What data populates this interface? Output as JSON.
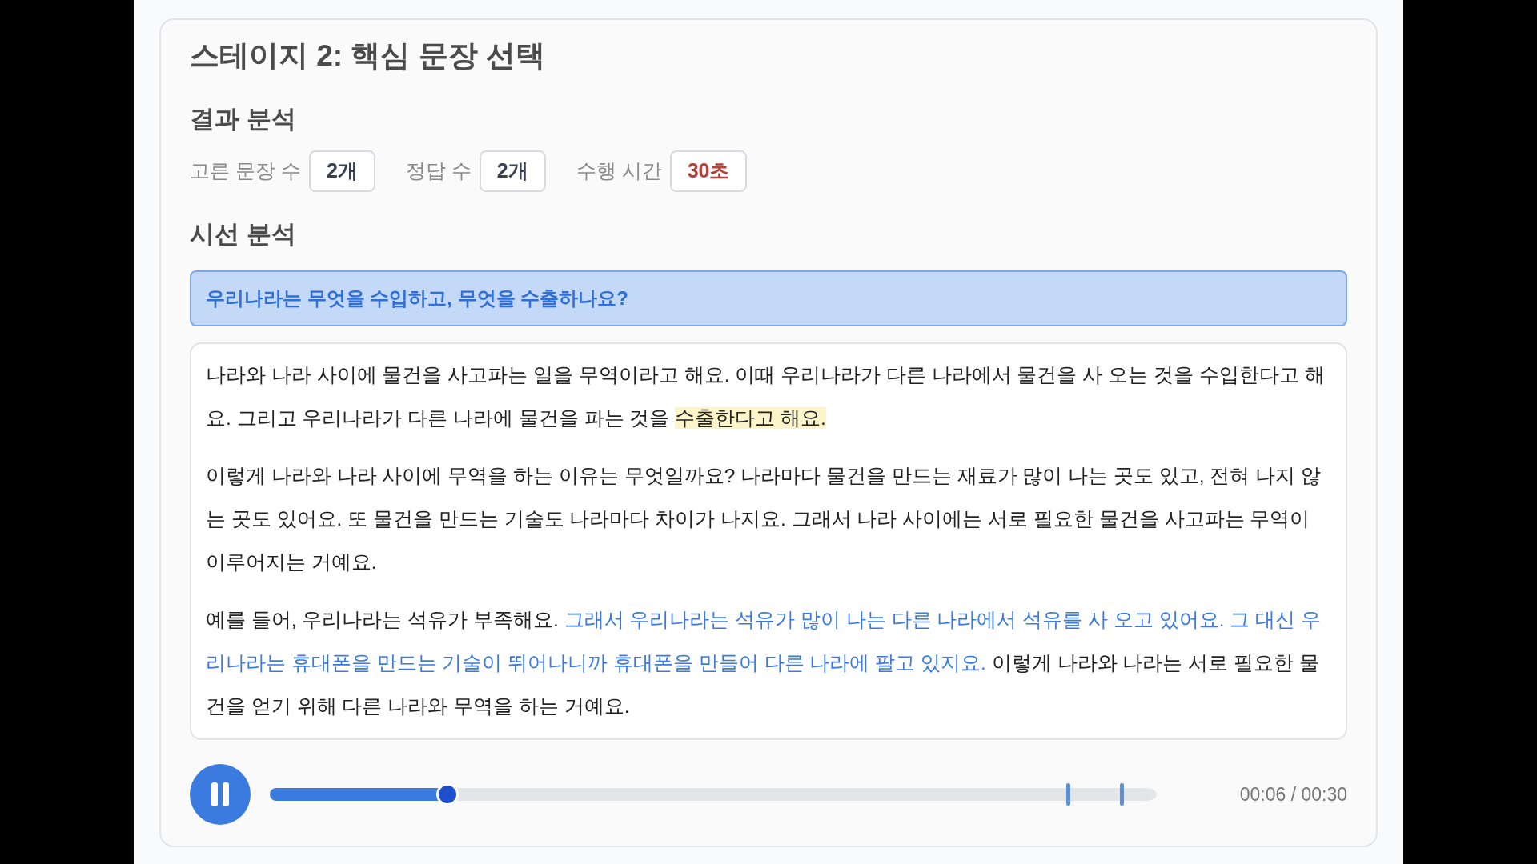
{
  "title": "스테이지 2: 핵심 문장 선택",
  "result_heading": "결과 분석",
  "stats": [
    {
      "label": "고른 문장 수",
      "value": "2개",
      "color": "#374151"
    },
    {
      "label": "정답 수",
      "value": "2개",
      "color": "#374151"
    },
    {
      "label": "수행 시간",
      "value": "30초",
      "color": "#b5403a"
    }
  ],
  "gaze_heading": "시선 분석",
  "question": "우리나라는 무엇을 수입하고, 무엇을 수출하나요?",
  "paragraphs": [
    [
      {
        "kind": "plain",
        "text": "나라와 나라 사이에 물건을 사고파는 일을 무역이라고 해요. 이때 우리나라가 다른 나라에서 물건을 사 오는 것을 수입한다고 해요. 그리고 우리나라가 다른 나라에 물건을 파는 것을 "
      },
      {
        "kind": "highlight",
        "text": "수출한다고 해요."
      }
    ],
    [
      {
        "kind": "plain",
        "text": "이렇게 나라와 나라 사이에 무역을 하는 이유는 무엇일까요? 나라마다 물건을 만드는 재료가 많이 나는 곳도 있고, 전혀 나지 않는 곳도 있어요. 또 물건을 만드는 기술도 나라마다 차이가 나지요. 그래서 나라 사이에는 서로 필요한 물건을 사고파는 무역이 이루어지는 거예요."
      }
    ],
    [
      {
        "kind": "plain",
        "text": "예를 들어, 우리나라는 석유가 부족해요. "
      },
      {
        "kind": "gaze",
        "text": "그래서 우리나라는 석유가 많이 나는 다른 나라에서 석유를 사 오고 있어요. 그 대신 우리나라는 휴대폰을 만드는 기술이 뛰어나니까 휴대폰을 만들어 다른 나라에 팔고 있지요."
      },
      {
        "kind": "plain",
        "text": " 이렇게 나라와 나라는 서로 필요한 물건을 얻기 위해 다른 나라와 무역을 하는 거예요."
      }
    ]
  ],
  "player": {
    "playing": true,
    "level": 0.2,
    "markers": [
      {
        "level": 0.9
      },
      {
        "level": 0.96
      }
    ],
    "time": "00:06 / 00:30"
  }
}
